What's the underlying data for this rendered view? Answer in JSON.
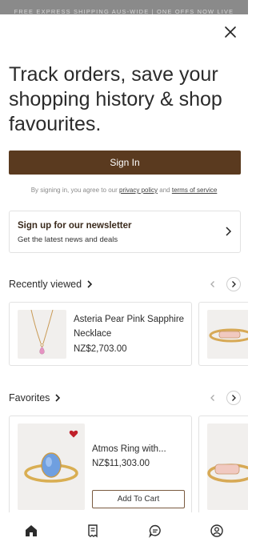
{
  "announcement": "FREE EXPRESS SHIPPING AUS-WIDE | ONE OFFS NOW LIVE",
  "headline": "Track orders, save your shopping history & shop favourites.",
  "sign_in_label": "Sign In",
  "terms": {
    "prefix": "By signing in, you agree to our",
    "privacy": "privacy policy",
    "and": "and",
    "service": "terms of service"
  },
  "newsletter": {
    "title": "Sign up for our newsletter",
    "subtitle": "Get the latest news and deals"
  },
  "recently_viewed": {
    "title": "Recently viewed",
    "items": [
      {
        "name": "Asteria Pear Pink Sapphire Necklace",
        "price": "NZ$2,703.00"
      }
    ]
  },
  "favorites": {
    "title": "Favorites",
    "items": [
      {
        "name": "Atmos Ring with...",
        "price": "NZ$11,303.00",
        "add_to_cart": "Add To Cart"
      }
    ]
  },
  "colors": {
    "brand": "#5a3a1f",
    "heart": "#c0202a",
    "announce_bg": "#8a8a8a"
  },
  "bottom_nav": [
    "home-icon",
    "receipt-icon",
    "chat-icon",
    "account-icon"
  ]
}
